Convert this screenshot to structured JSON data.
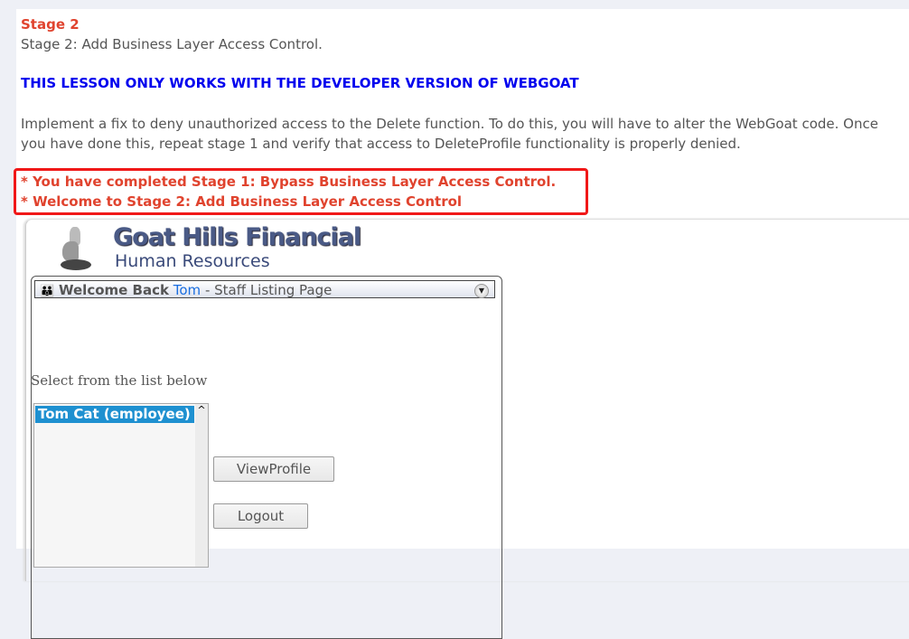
{
  "stage": {
    "title": "Stage 2",
    "subtitle": "Stage 2: Add Business Layer Access Control."
  },
  "warning": "THIS LESSON ONLY WORKS WITH THE DEVELOPER VERSION OF WEBGOAT",
  "description": "Implement a fix to deny unauthorized access to the Delete function. To do this, you will have to alter the WebGoat code. Once you have done this, repeat stage 1 and verify that access to DeleteProfile functionality is properly denied.",
  "messages": [
    "* You have completed Stage 1: Bypass Business Layer Access Control.",
    "* Welcome to Stage 2: Add Business Layer Access Control"
  ],
  "app": {
    "logo_title": "Goat Hills Financial",
    "logo_subtitle": "Human Resources",
    "welcome_prefix": "Welcome Back",
    "user": "Tom",
    "welcome_suffix": " - Staff Listing Page",
    "select_label": "Select from the list below",
    "list_items": [
      "Tom Cat (employee)"
    ],
    "buttons": {
      "view": "ViewProfile",
      "logout": "Logout"
    }
  },
  "colors": {
    "accent_red": "#e0432e",
    "link_blue": "#0000ee",
    "selection": "#1e90d0"
  }
}
